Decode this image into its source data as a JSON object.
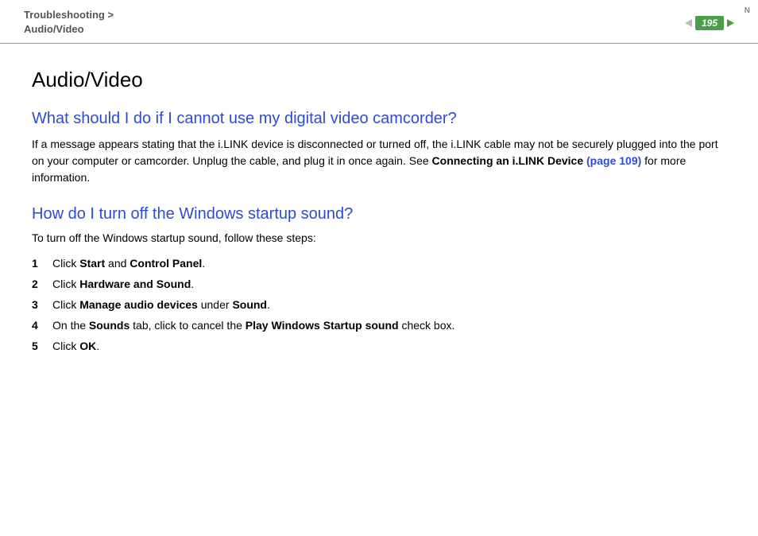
{
  "header": {
    "breadcrumb_line1": "Troubleshooting >",
    "breadcrumb_line2": "Audio/Video",
    "page_number": "195",
    "n_mark": "N"
  },
  "content": {
    "title": "Audio/Video",
    "section1": {
      "question": "What should I do if I cannot use my digital video camcorder?",
      "body_part1": "If a message appears stating that the i.LINK device is disconnected or turned off, the i.LINK cable may not be securely plugged into the port on your computer or camcorder. Unplug the cable, and plug it in once again. See ",
      "body_bold": "Connecting an i.LINK Device ",
      "body_link": "(page 109)",
      "body_part2": " for more information."
    },
    "section2": {
      "question": "How do I turn off the Windows startup sound?",
      "intro": "To turn off the Windows startup sound, follow these steps:",
      "steps": [
        {
          "pre": "Click ",
          "b1": "Start",
          "mid": " and ",
          "b2": "Control Panel",
          "post": "."
        },
        {
          "pre": "Click ",
          "b1": "Hardware and Sound",
          "mid": "",
          "b2": "",
          "post": "."
        },
        {
          "pre": "Click ",
          "b1": "Manage audio devices",
          "mid": " under ",
          "b2": "Sound",
          "post": "."
        },
        {
          "pre": "On the ",
          "b1": "Sounds",
          "mid": " tab, click to cancel the ",
          "b2": "Play Windows Startup sound",
          "post": " check box."
        },
        {
          "pre": "Click ",
          "b1": "OK",
          "mid": "",
          "b2": "",
          "post": "."
        }
      ]
    }
  }
}
